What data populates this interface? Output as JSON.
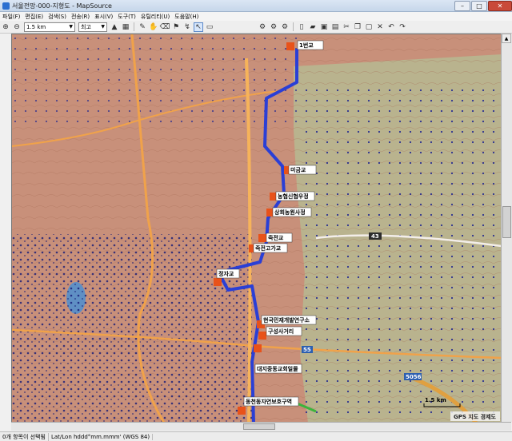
{
  "window": {
    "title": "서울전망-000-지형도 - MapSource"
  },
  "menu": [
    "파일(F)",
    "편집(E)",
    "검색(S)",
    "전송(R)",
    "표시(V)",
    "도구(T)",
    "유틸리티(U)",
    "도움말(H)"
  ],
  "toolbar": {
    "scale_value": "1.5 km",
    "detail_value": "최고"
  },
  "map": {
    "waypoints": [
      "1번교",
      "미금교",
      "농협신협우정",
      "상회농원사정",
      "죽전교",
      "죽전고가교",
      "정자교",
      "현국민재개발연구소",
      "구성사거리",
      "대지중동교회일몰",
      "동천동자연보호구역"
    ],
    "road_shields": [
      "43",
      "55",
      "5056"
    ],
    "scale_label": "1.5 km",
    "credit": "GPS 지도 경제도"
  },
  "status": {
    "selection": "0개 항목이 선택됨",
    "coord_format": "Lat/Lon hddd°mm.mmm' (WGS 84)"
  }
}
